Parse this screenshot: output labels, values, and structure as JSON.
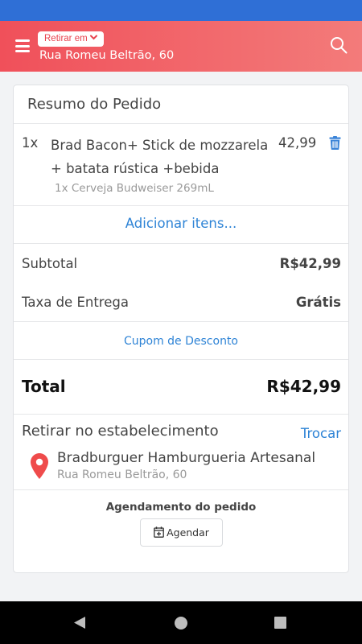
{
  "header": {
    "pickup_label": "Retirar em",
    "address": "Rua Romeu Beltrão, 60"
  },
  "summary": {
    "title": "Resumo do Pedido",
    "item": {
      "qty": "1x",
      "name": "Brad Bacon+ Stick de mozzarela + batata rústica +bebida",
      "price": "42,99",
      "extra": "1x Cerveja Budweiser 269mL"
    },
    "add_items": "Adicionar itens...",
    "subtotal_label": "Subtotal",
    "subtotal_value": "R$42,99",
    "delivery_label": "Taxa de Entrega",
    "delivery_value": "Grátis",
    "coupon": "Cupom de Desconto",
    "total_label": "Total",
    "total_value": "R$42,99"
  },
  "pickup": {
    "title": "Retirar no estabelecimento",
    "swap": "Trocar",
    "store_name": "Bradburguer Hamburgueria Artesanal",
    "store_address": "Rua Romeu Beltrão, 60"
  },
  "schedule": {
    "title": "Agendamento do pedido",
    "button": "Agendar"
  },
  "colors": {
    "header_start": "#f0505a",
    "header_end": "#f37b7a",
    "link": "#2f84d6",
    "status_bar": "#2f6fd6"
  },
  "icons": [
    "menu-icon",
    "chevron-down-icon",
    "search-icon",
    "trash-icon",
    "map-pin-icon",
    "calendar-plus-icon",
    "back-icon",
    "home-icon",
    "recent-apps-icon"
  ]
}
